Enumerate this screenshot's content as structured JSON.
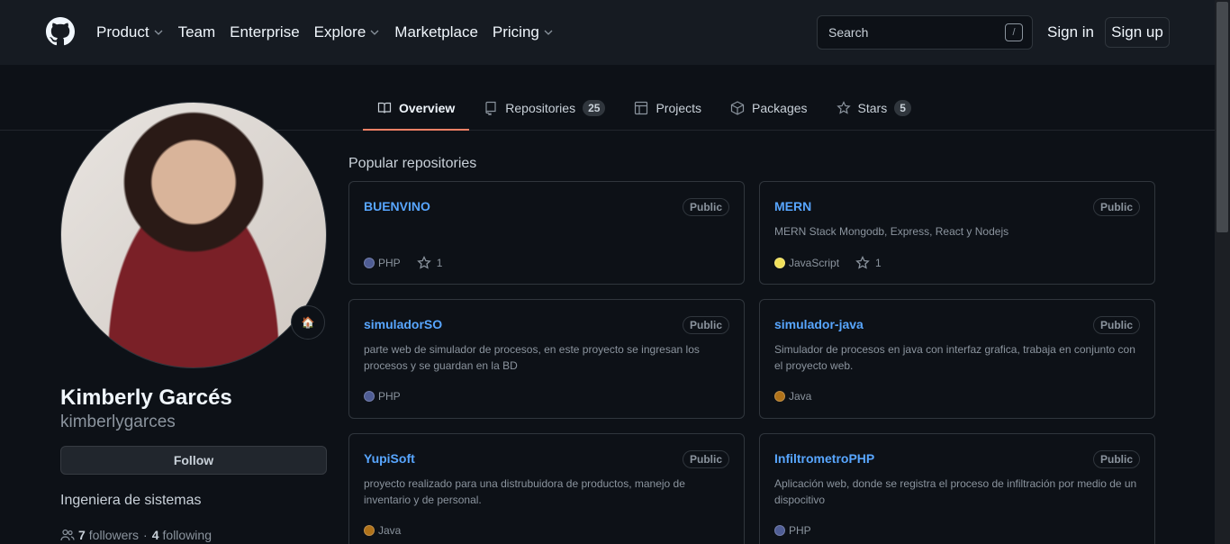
{
  "header": {
    "nav": [
      {
        "label": "Product",
        "dropdown": true
      },
      {
        "label": "Team",
        "dropdown": false
      },
      {
        "label": "Enterprise",
        "dropdown": false
      },
      {
        "label": "Explore",
        "dropdown": true
      },
      {
        "label": "Marketplace",
        "dropdown": false
      },
      {
        "label": "Pricing",
        "dropdown": true
      }
    ],
    "search_placeholder": "Search",
    "search_shortcut": "/",
    "signin": "Sign in",
    "signup": "Sign up"
  },
  "tabs": [
    {
      "label": "Overview",
      "icon": "book-icon",
      "count": null,
      "active": true
    },
    {
      "label": "Repositories",
      "icon": "repo-icon",
      "count": "25",
      "active": false
    },
    {
      "label": "Projects",
      "icon": "table-icon",
      "count": null,
      "active": false
    },
    {
      "label": "Packages",
      "icon": "package-icon",
      "count": null,
      "active": false
    },
    {
      "label": "Stars",
      "icon": "star-icon",
      "count": "5",
      "active": false
    }
  ],
  "profile": {
    "fullname": "Kimberly Garcés",
    "username": "kimberlygarces",
    "status_emoji": "🏠",
    "follow_label": "Follow",
    "bio": "Ingeniera de sistemas",
    "followers_count": "7",
    "followers_label": "followers",
    "separator": "·",
    "following_count": "4",
    "following_label": "following"
  },
  "popular": {
    "title": "Popular repositories",
    "repos": [
      {
        "name": "BUENVINO",
        "visibility": "Public",
        "description": "",
        "language": "PHP",
        "lang_color": "#4F5D95",
        "stars": "1"
      },
      {
        "name": "MERN",
        "visibility": "Public",
        "description": "MERN Stack Mongodb, Express, React y Nodejs",
        "language": "JavaScript",
        "lang_color": "#f1e05a",
        "stars": "1"
      },
      {
        "name": "simuladorSO",
        "visibility": "Public",
        "description": "parte web de simulador de procesos, en este proyecto se ingresan los procesos y se guardan en la BD",
        "language": "PHP",
        "lang_color": "#4F5D95",
        "stars": ""
      },
      {
        "name": "simulador-java",
        "visibility": "Public",
        "description": "Simulador de procesos en java con interfaz grafica, trabaja en conjunto con el proyecto web.",
        "language": "Java",
        "lang_color": "#b07219",
        "stars": ""
      },
      {
        "name": "YupiSoft",
        "visibility": "Public",
        "description": "proyecto realizado para una distrubuidora de productos, manejo de inventario y de personal.",
        "language": "Java",
        "lang_color": "#b07219",
        "stars": ""
      },
      {
        "name": "InfiltrometroPHP",
        "visibility": "Public",
        "description": "Aplicación web, donde se registra el proceso de infiltración por medio de un dispocitivo",
        "language": "PHP",
        "lang_color": "#4F5D95",
        "stars": ""
      }
    ]
  }
}
